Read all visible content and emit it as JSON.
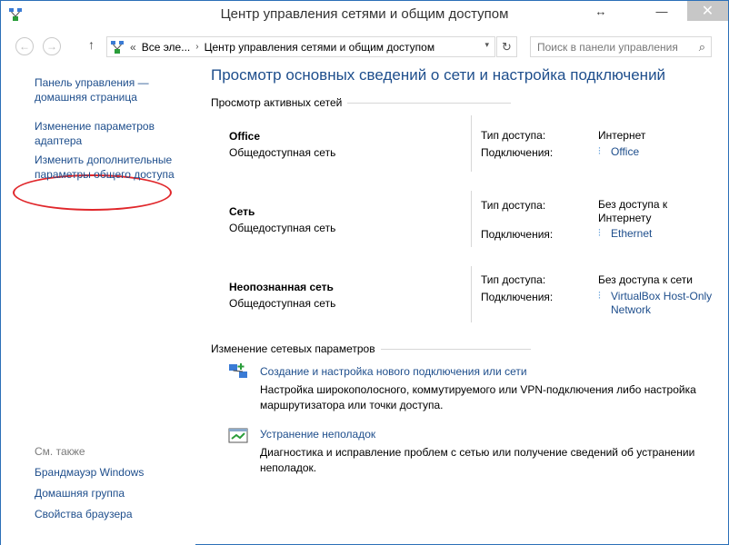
{
  "window": {
    "title": "Центр управления сетями и общим доступом",
    "restore_glyph": "↔",
    "minimize_glyph": "—",
    "close_glyph": "✕"
  },
  "navbar": {
    "back_glyph": "←",
    "forward_glyph": "→",
    "up_glyph": "↑",
    "chevrons": "«",
    "segments": [
      "Все эле...",
      "Центр управления сетями и общим доступом"
    ],
    "separator": "›",
    "dropdown_glyph": "▾",
    "refresh_glyph": "↻",
    "search_placeholder": "Поиск в панели управления",
    "search_glyph": "⌕"
  },
  "sidebar": {
    "links": [
      {
        "line1": "Панель управления —",
        "line2": "домашняя страница"
      },
      {
        "line1": "Изменение параметров",
        "line2": "адаптера"
      },
      {
        "line1": "Изменить дополнительные",
        "line2": "параметры общего доступа"
      }
    ],
    "see_also_label": "См. также",
    "see_also": [
      "Брандмауэр Windows",
      "Домашняя группа",
      "Свойства браузера"
    ],
    "highlight_color": "#e0262a"
  },
  "main": {
    "heading": "Просмотр основных сведений о сети и настройка подключений",
    "active_networks_title": "Просмотр активных сетей",
    "access_label": "Тип доступа:",
    "connections_label": "Подключения:",
    "networks": [
      {
        "name": "Office",
        "type": "Общедоступная сеть",
        "access": [
          "Интернет"
        ],
        "connection": [
          "Office"
        ]
      },
      {
        "name": "Сеть",
        "type": "Общедоступная сеть",
        "access": [
          "Без доступа к",
          "Интернету"
        ],
        "connection": [
          "Ethernet"
        ]
      },
      {
        "name": "Неопознанная сеть",
        "type": "Общедоступная сеть",
        "access": [
          "Без доступа к сети"
        ],
        "connection": [
          "VirtualBox Host-Only",
          "Network"
        ]
      }
    ],
    "change_settings_title": "Изменение сетевых параметров",
    "tasks": [
      {
        "link": "Создание и настройка нового подключения или сети",
        "desc": [
          "Настройка широкополосного, коммутируемого или VPN-подключения либо настройка",
          "маршрутизатора или точки доступа."
        ],
        "icon": "new-connection-icon"
      },
      {
        "link": "Устранение неполадок",
        "desc": [
          "Диагностика и исправление проблем с сетью или получение сведений об устранении",
          "неполадок."
        ],
        "icon": "troubleshoot-icon"
      }
    ],
    "link_color": "#1e4e8c"
  }
}
